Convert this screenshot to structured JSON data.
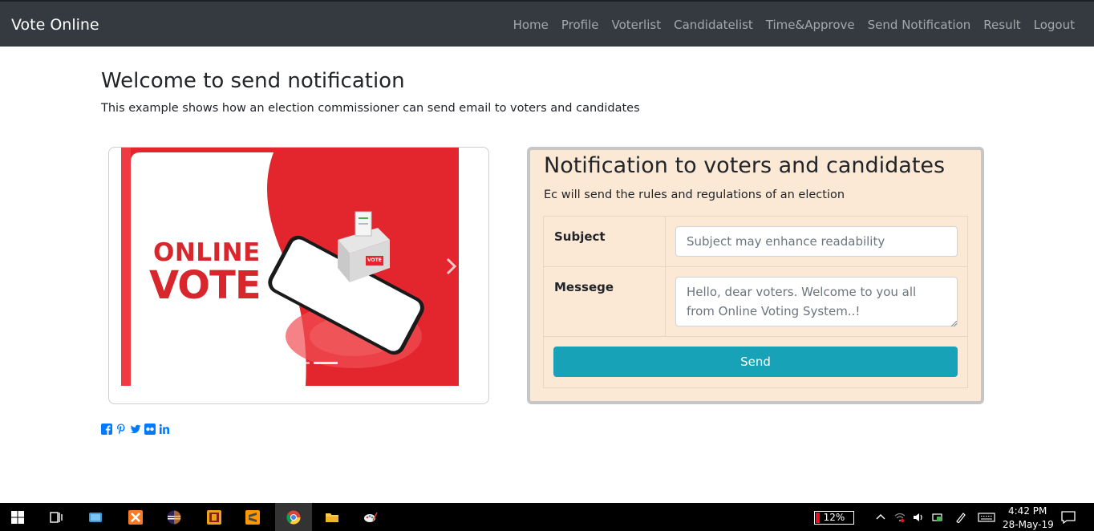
{
  "navbar": {
    "brand": "Vote Online",
    "links": [
      "Home",
      "Profile",
      "Voterlist",
      "Candidatelist",
      "Time&Approve",
      "Send Notification",
      "Result",
      "Logout"
    ]
  },
  "header": {
    "title": "Welcome to send notification",
    "subtitle": "This example shows how an election commissioner can send email to voters and candidates"
  },
  "carousel": {
    "slide_text_line1": "ONLINE",
    "slide_text_line2": "VOTE",
    "ballot_label": "VOTE",
    "next_icon": "chevron-right-icon"
  },
  "notification": {
    "title": "Notification to voters and candidates",
    "subtitle": "Ec will send the rules and regulations of an election",
    "subject_label": "Subject",
    "subject_placeholder": "Subject may enhance readability",
    "message_label": "Messege",
    "message_placeholder": "Hello, dear voters. Welcome to you all from Online Voting System..!",
    "send_label": "Send"
  },
  "social": [
    "facebook-icon",
    "pinterest-icon",
    "twitter-icon",
    "flickr-icon",
    "linkedin-icon"
  ],
  "taskbar": {
    "battery": "12%",
    "time": "4:42 PM",
    "date": "28-May-19"
  },
  "colors": {
    "navbar_bg": "#343a40",
    "card_bg": "#fbe9d6",
    "send_btn": "#17a2b8",
    "social": "#007bff"
  }
}
